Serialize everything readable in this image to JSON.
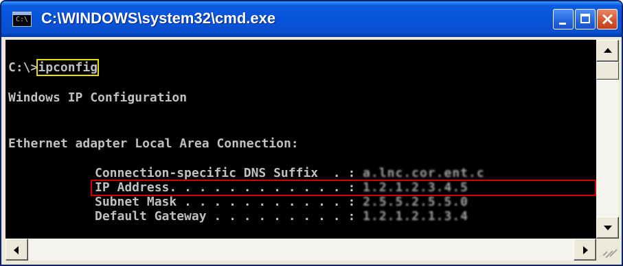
{
  "window": {
    "title": "C:\\WINDOWS\\system32\\cmd.exe",
    "icon": "cmd-icon",
    "icon_glyph": "C:\\"
  },
  "console": {
    "prompt": "C:\\>",
    "command": "ipconfig",
    "heading": "Windows IP Configuration",
    "adapter": "Ethernet adapter Local Area Connection:",
    "rows": [
      {
        "label": "Connection-specific DNS Suffix  . :",
        "value": "blurred",
        "highlighted": false
      },
      {
        "label": "IP Address. . . . . . . . . . . . :",
        "value": "blurred",
        "highlighted": true
      },
      {
        "label": "Subnet Mask . . . . . . . . . . . :",
        "value": "blurred",
        "highlighted": false
      },
      {
        "label": "Default Gateway . . . . . . . . . :",
        "value": "blurred",
        "highlighted": false
      }
    ]
  },
  "colors": {
    "console_bg": "#000000",
    "console_text": "#c0c0c0",
    "command_highlight": "#e8e000",
    "ip_highlight": "#d00000",
    "titlebar": "#0653d8"
  }
}
